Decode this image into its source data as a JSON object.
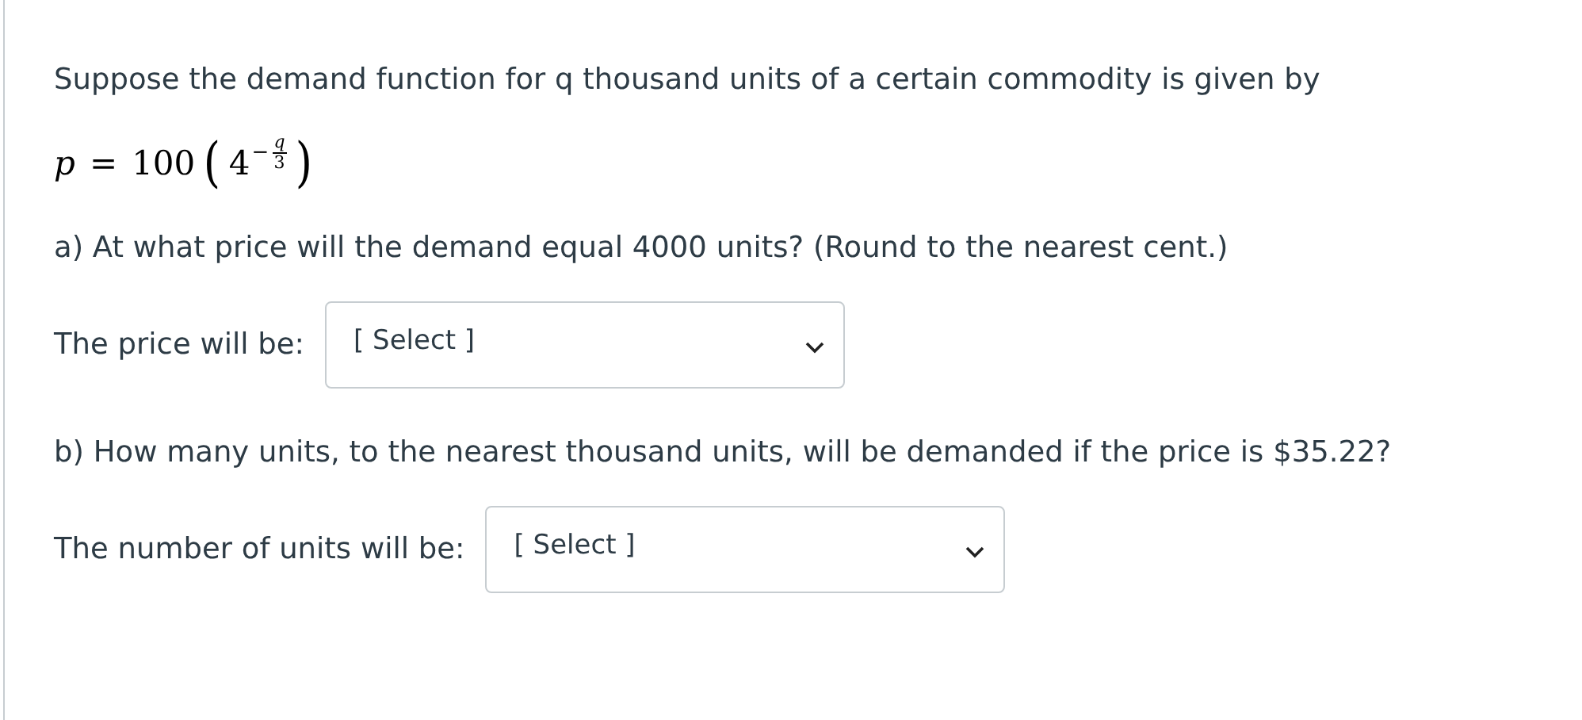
{
  "intro": "Suppose the demand function for q thousand units of a certain commodity is given by",
  "formula": {
    "lhs": "p",
    "equals": "=",
    "coefficient": "100",
    "open": "(",
    "base": "4",
    "minus": "−",
    "numerator": "q",
    "denominator": "3",
    "close": ")"
  },
  "questions": [
    {
      "text": "a) At what price will the demand equal 4000 units? (Round to the nearest cent.)",
      "label": "The price will be:",
      "dropdown": "[ Select ]"
    },
    {
      "text": "b) How many units, to the nearest thousand units, will be demanded if the price is $35.22?",
      "label": "The number of units will be:",
      "dropdown": "[ Select ]"
    }
  ]
}
